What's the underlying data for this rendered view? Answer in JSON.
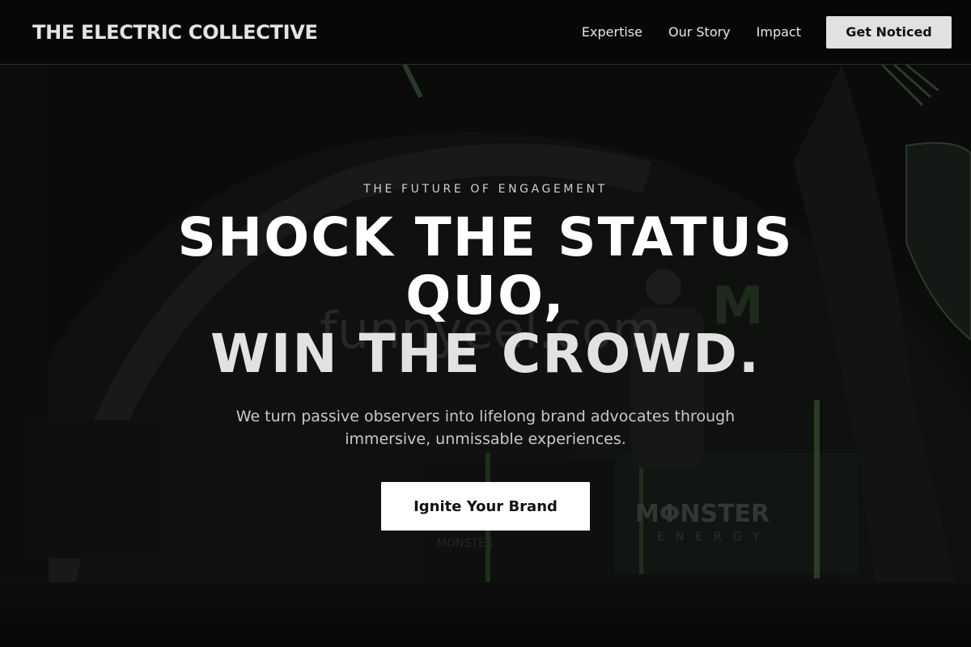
{
  "header": {
    "brand": "THE ELECTRIC COLLECTIVE",
    "nav": [
      {
        "label": "Expertise"
      },
      {
        "label": "Our Story"
      },
      {
        "label": "Impact"
      }
    ],
    "cta_label": "Get Noticed"
  },
  "hero": {
    "eyebrow": "THE FUTURE OF ENGAGEMENT",
    "headline_line1": "SHOCK THE STATUS QUO,",
    "headline_line2": "WIN THE CROWD.",
    "subtext": "We turn passive observers into lifelong brand advocates through immersive, unmissable experiences.",
    "cta_label": "Ignite Your Brand"
  },
  "background": {
    "watermark": "funnyeel.com",
    "booth_logo": "MΦNSTER",
    "booth_sub": "ENERGY",
    "counter_text": "MONSTER",
    "tent_emblem": "M",
    "accent_color": "#3f6b35"
  },
  "colors": {
    "page_bg": "#0b0c0b",
    "header_bg": "#060706",
    "cta_bg": "#ffffff",
    "nav_cta_bg": "#e1e1e1",
    "text": "#ffffff"
  }
}
